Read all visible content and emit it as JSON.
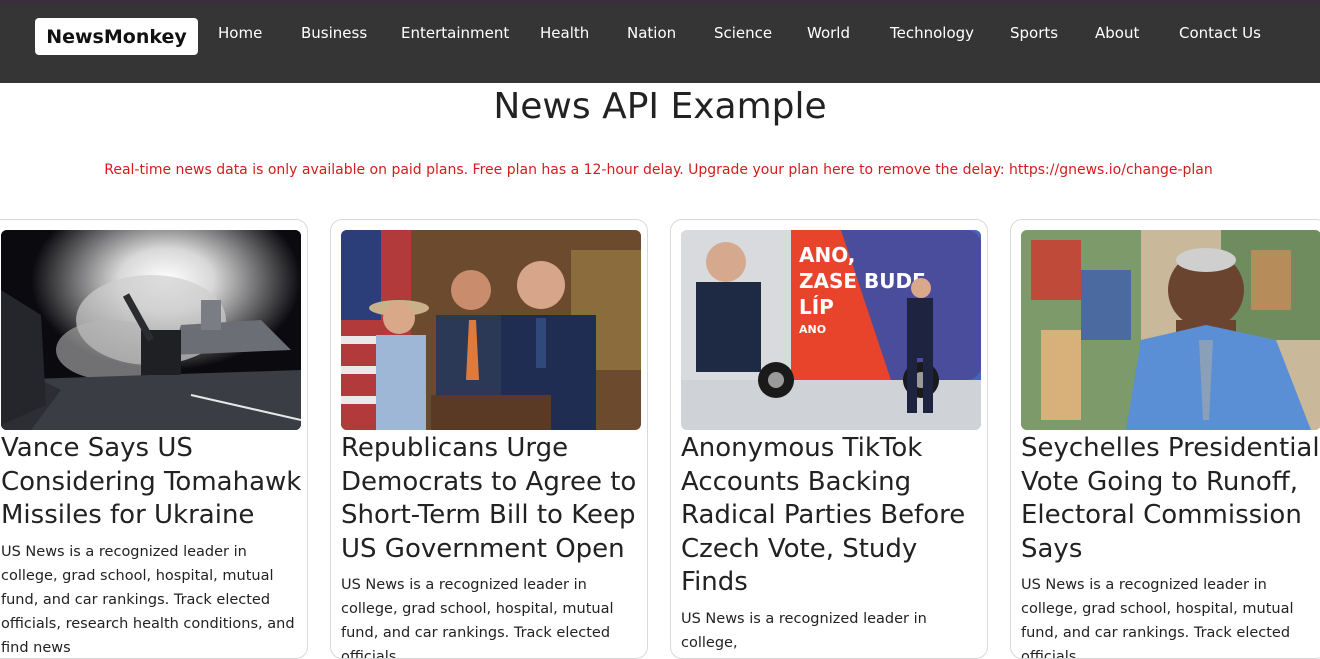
{
  "nav": {
    "brand": "NewsMonkey",
    "links": [
      "Home",
      "Business",
      "Entertainment",
      "Health",
      "Nation",
      "Science",
      "World",
      "Technology",
      "Sports",
      "About",
      "Contact Us"
    ]
  },
  "page": {
    "title": "News API Example",
    "notice": "Real-time news data is only available on paid plans. Free plan has a 12-hour delay. Upgrade your plan here to remove the delay: https://gnews.io/change-plan"
  },
  "cards": [
    {
      "title": "Vance Says US Considering Tomahawk Missiles for Ukraine",
      "description": "US News is a recognized leader in college, grad school, hospital, mutual fund, and car rankings. Track elected officials, research health conditions, and find news"
    },
    {
      "title": "Republicans Urge Democrats to Agree to Short-Term Bill to Keep US Government Open",
      "description": "US News is a recognized leader in college, grad school, hospital, mutual fund, and car rankings. Track elected officials"
    },
    {
      "title": "Anonymous TikTok Accounts Backing Radical Parties Before Czech Vote, Study Finds",
      "description": "US News is a recognized leader in college,",
      "image_text": [
        "ANO,",
        "ZASE BUDE",
        "LÍP",
        "ANO"
      ]
    },
    {
      "title": "Seychelles Presidential Vote Going to Runoff, Electoral Commission Says",
      "description": "US News is a recognized leader in college, grad school, hospital, mutual fund, and car rankings. Track elected officials"
    }
  ],
  "colors": {
    "navbar": "#353535",
    "notice": "#d21d1d",
    "card_border": "#d9d9d9"
  }
}
